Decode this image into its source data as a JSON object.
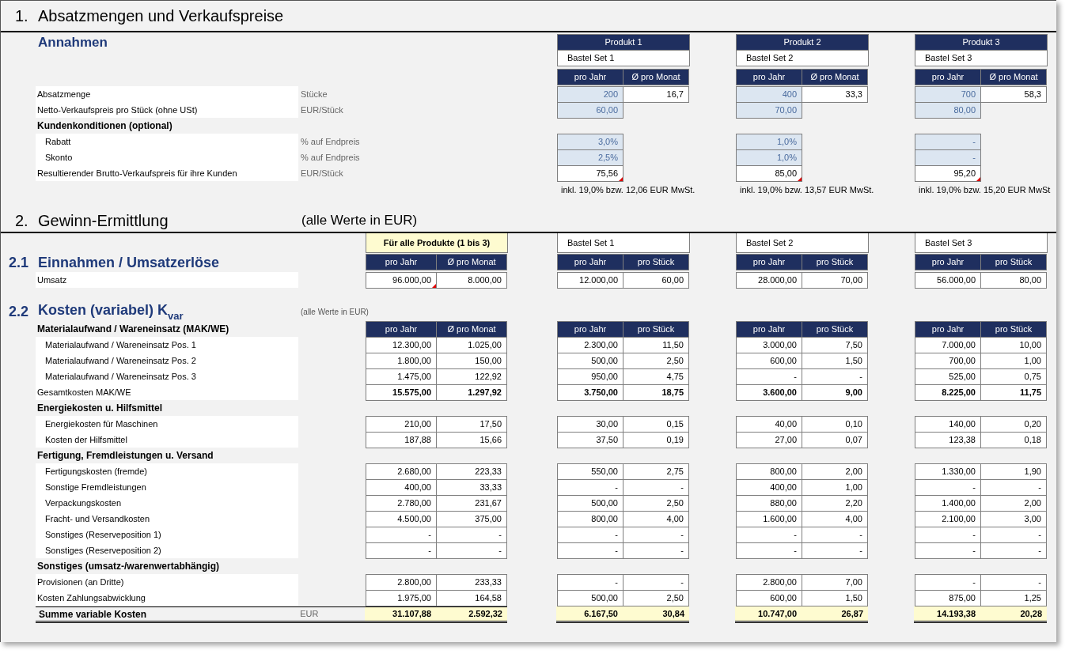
{
  "section1": {
    "number": "1.",
    "title": "Absatzmengen und Verkaufspreise",
    "subtitle": "Annahmen",
    "products": [
      {
        "header": "Produkt 1",
        "name": "Bastel Set 1",
        "column_headers": [
          "pro Jahr",
          "Ø pro Monat"
        ],
        "vat_note": "inkl. 19,0% bzw. 12,06 EUR MwSt."
      },
      {
        "header": "Produkt 2",
        "name": "Bastel Set 2",
        "column_headers": [
          "pro Jahr",
          "Ø pro Monat"
        ],
        "vat_note": "inkl. 19,0% bzw. 13,57 EUR MwSt."
      },
      {
        "header": "Produkt 3",
        "name": "Bastel Set 3",
        "column_headers": [
          "pro Jahr",
          "Ø pro Monat"
        ],
        "vat_note": "inkl. 19,0% bzw. 15,20 EUR MwSt"
      }
    ],
    "rows": [
      {
        "kind": "item",
        "label": "Absatzmenge",
        "unit": "Stücke",
        "cells": [
          [
            {
              "value": "200",
              "input": true
            },
            {
              "value": "16,7",
              "input": false
            }
          ],
          [
            {
              "value": "400",
              "input": true
            },
            {
              "value": "33,3",
              "input": false
            }
          ],
          [
            {
              "value": "700",
              "input": true
            },
            {
              "value": "58,3",
              "input": false
            }
          ]
        ]
      },
      {
        "kind": "item",
        "label": "Netto-Verkaufspreis pro Stück (ohne USt)",
        "unit": "EUR/Stück",
        "cells": [
          [
            {
              "value": "60,00",
              "input": true
            }
          ],
          [
            {
              "value": "70,00",
              "input": true
            }
          ],
          [
            {
              "value": "80,00",
              "input": true
            }
          ]
        ]
      },
      {
        "kind": "group",
        "label": "Kundenkonditionen (optional)",
        "children": [
          {
            "kind": "item",
            "label": "Rabatt",
            "unit": "% auf Endpreis",
            "cells": [
              [
                {
                  "value": "3,0%",
                  "input": true
                }
              ],
              [
                {
                  "value": "1,0%",
                  "input": true
                }
              ],
              [
                {
                  "value": "-",
                  "input": true
                }
              ]
            ]
          },
          {
            "kind": "item",
            "label": "Skonto",
            "unit": "% auf Endpreis",
            "cells": [
              [
                {
                  "value": "2,5%",
                  "input": true
                }
              ],
              [
                {
                  "value": "1,0%",
                  "input": true
                }
              ],
              [
                {
                  "value": "-",
                  "input": true
                }
              ]
            ]
          }
        ]
      },
      {
        "kind": "item",
        "label": "Resultierender Brutto-Verkaufspreis für ihre Kunden",
        "unit": "EUR/Stück",
        "cells": [
          [
            {
              "value": "75,56",
              "input": false,
              "note": true
            }
          ],
          [
            {
              "value": "85,00",
              "input": false,
              "note": true
            }
          ],
          [
            {
              "value": "95,20",
              "input": false,
              "note": true
            }
          ]
        ]
      }
    ]
  },
  "section2": {
    "number": "2.",
    "title": "Gewinn-Ermittlung",
    "subtitle": "(alle Werte in EUR)",
    "all_products_label": "Für alle Produkte (1 bis 3)",
    "product_names": [
      "Bastel Set 1",
      "Bastel Set 2",
      "Bastel Set 3"
    ],
    "revenue": {
      "number": "2.1",
      "title": "Einnahmen / Umsatzerlöse",
      "column_headers": [
        [
          "pro Jahr",
          "Ø pro Monat"
        ],
        [
          "pro Jahr",
          "pro Stück"
        ],
        [
          "pro Jahr",
          "pro Stück"
        ],
        [
          "pro Jahr",
          "pro Stück"
        ]
      ],
      "rows": [
        {
          "label": "Umsatz",
          "cells": [
            {
              "value": "96.000,00",
              "note": true
            },
            {
              "value": "8.000,00",
              "note": false
            },
            {
              "value": "12.000,00",
              "note": false
            },
            {
              "value": "60,00",
              "note": false
            },
            {
              "value": "28.000,00",
              "note": false
            },
            {
              "value": "70,00",
              "note": false
            },
            {
              "value": "56.000,00",
              "note": false
            },
            {
              "value": "80,00",
              "note": false
            }
          ]
        }
      ]
    },
    "variable_costs": {
      "number": "2.2",
      "title": "Kosten (variabel) K$_{var}$",
      "note": "(alle Werte in EUR)",
      "column_headers": [
        [
          "pro Jahr",
          "Ø pro Monat"
        ],
        [
          "pro Jahr",
          "pro Stück"
        ],
        [
          "pro Jahr",
          "pro Stück"
        ],
        [
          "pro Jahr",
          "pro Stück"
        ]
      ],
      "groups": [
        {
          "label": "Materialaufwand / Wareneinsatz (MAK/WE)",
          "children": [
            {
              "kind": "sub",
              "label": "Materialaufwand / Wareneinsatz Pos. 1",
              "values": [
                "12.300,00",
                "1.025,00",
                "2.300,00",
                "11,50",
                "3.000,00",
                "7,50",
                "7.000,00",
                "10,00"
              ]
            },
            {
              "kind": "sub",
              "label": "Materialaufwand / Wareneinsatz Pos. 2",
              "values": [
                "1.800,00",
                "150,00",
                "500,00",
                "2,50",
                "600,00",
                "1,50",
                "700,00",
                "1,00"
              ]
            },
            {
              "kind": "sub",
              "label": "Materialaufwand / Wareneinsatz Pos. 3",
              "values": [
                "1.475,00",
                "122,92",
                "950,00",
                "4,75",
                "-",
                "-",
                "525,00",
                "0,75"
              ]
            },
            {
              "kind": "total",
              "label": "Gesamtkosten MAK/WE",
              "values": [
                "15.575,00",
                "1.297,92",
                "3.750,00",
                "18,75",
                "3.600,00",
                "9,00",
                "8.225,00",
                "11,75"
              ]
            }
          ]
        },
        {
          "label": "Energiekosten u. Hilfsmittel",
          "children": [
            {
              "kind": "sub",
              "label": "Energiekosten für Maschinen",
              "values": [
                "210,00",
                "17,50",
                "30,00",
                "0,15",
                "40,00",
                "0,10",
                "140,00",
                "0,20"
              ]
            },
            {
              "kind": "sub",
              "label": "Kosten der Hilfsmittel",
              "values": [
                "187,88",
                "15,66",
                "37,50",
                "0,19",
                "27,00",
                "0,07",
                "123,38",
                "0,18"
              ]
            }
          ]
        },
        {
          "label": "Fertigung, Fremdleistungen u. Versand",
          "children": [
            {
              "kind": "sub",
              "label": "Fertigungskosten (fremde)",
              "values": [
                "2.680,00",
                "223,33",
                "550,00",
                "2,75",
                "800,00",
                "2,00",
                "1.330,00",
                "1,90"
              ]
            },
            {
              "kind": "sub",
              "label": "Sonstige Fremdleistungen",
              "values": [
                "400,00",
                "33,33",
                "-",
                "-",
                "400,00",
                "1,00",
                "-",
                "-"
              ]
            },
            {
              "kind": "sub",
              "label": "Verpackungskosten",
              "values": [
                "2.780,00",
                "231,67",
                "500,00",
                "2,50",
                "880,00",
                "2,20",
                "1.400,00",
                "2,00"
              ]
            },
            {
              "kind": "sub",
              "label": "Fracht- und Versandkosten",
              "values": [
                "4.500,00",
                "375,00",
                "800,00",
                "4,00",
                "1.600,00",
                "4,00",
                "2.100,00",
                "3,00"
              ]
            },
            {
              "kind": "sub",
              "label": "Sonstiges (Reserveposition 1)",
              "values": [
                "-",
                "-",
                "-",
                "-",
                "-",
                "-",
                "-",
                "-"
              ]
            },
            {
              "kind": "sub",
              "label": "Sonstiges (Reserveposition 2)",
              "values": [
                "-",
                "-",
                "-",
                "-",
                "-",
                "-",
                "-",
                "-"
              ]
            }
          ]
        },
        {
          "label": "Sonstiges (umsatz-/warenwertabhängig)",
          "children": [
            {
              "kind": "line",
              "label": "Provisionen (an Dritte)",
              "values": [
                "2.800,00",
                "233,33",
                "-",
                "-",
                "2.800,00",
                "7,00",
                "-",
                "-"
              ]
            },
            {
              "kind": "line",
              "label": "Kosten Zahlungsabwicklung",
              "values": [
                "1.975,00",
                "164,58",
                "500,00",
                "2,50",
                "600,00",
                "1,50",
                "875,00",
                "1,25"
              ]
            }
          ]
        }
      ],
      "sum": {
        "label": "Summe variable Kosten",
        "unit": "EUR",
        "values": [
          "31.107,88",
          "2.592,32",
          "6.167,50",
          "30,84",
          "10.747,00",
          "26,87",
          "14.193,38",
          "20,28"
        ]
      }
    }
  }
}
